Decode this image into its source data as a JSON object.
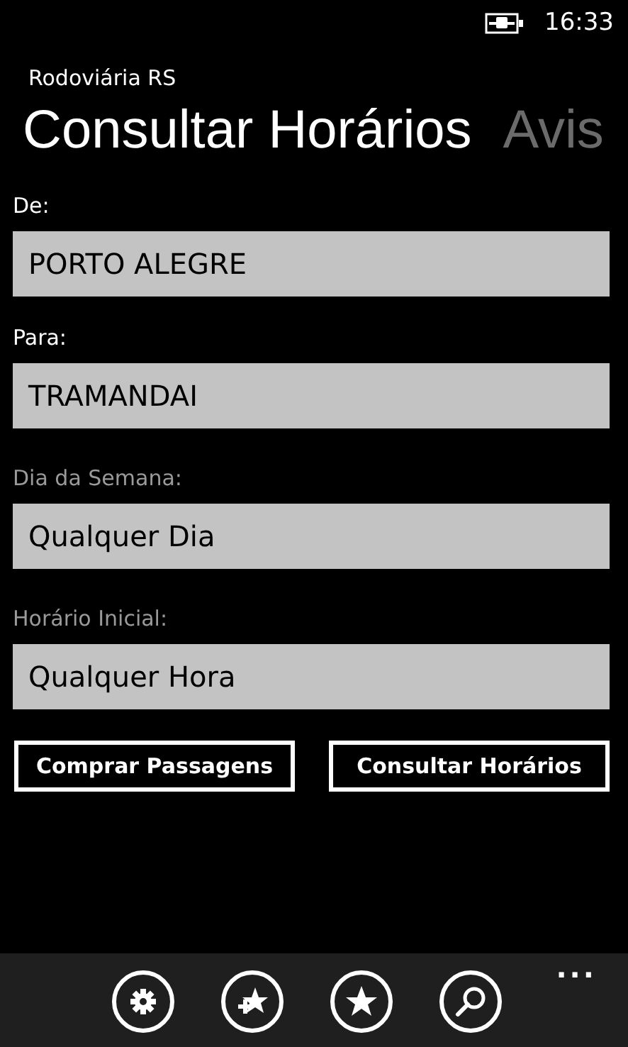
{
  "status_bar": {
    "time": "16:33"
  },
  "app_title": "Rodoviária RS",
  "pivot": [
    {
      "label": "Consultar Horários",
      "selected": true
    },
    {
      "label": "Avis",
      "selected": false
    }
  ],
  "fields": [
    {
      "label": "De:",
      "value": "PORTO ALEGRE",
      "kind": "text"
    },
    {
      "label": "Para:",
      "value": "TRAMANDAI",
      "kind": "text"
    },
    {
      "label": "Dia da Semana:",
      "value": "Qualquer Dia",
      "kind": "picker"
    },
    {
      "label": "Horário Inicial:",
      "value": "Qualquer Hora",
      "kind": "picker"
    }
  ],
  "buttons": [
    "Comprar Passagens",
    "Consultar Horários"
  ],
  "app_bar": {
    "icons": [
      {
        "kind": "settings"
      },
      {
        "kind": "add-favorite"
      },
      {
        "kind": "favorite"
      },
      {
        "kind": "search"
      }
    ],
    "more": "..."
  }
}
